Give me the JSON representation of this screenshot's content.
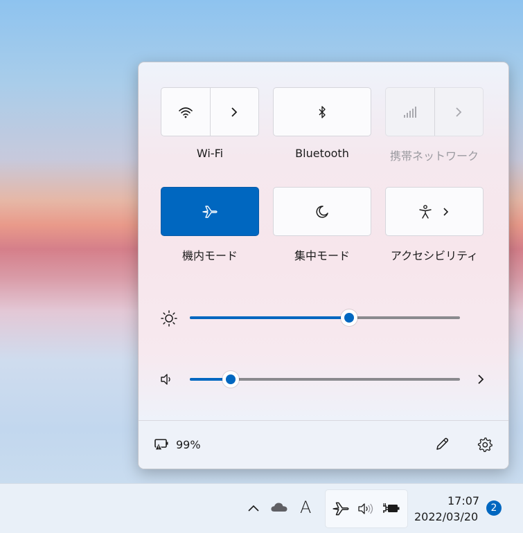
{
  "quick_settings": {
    "tiles": [
      {
        "id": "wifi",
        "label": "Wi-Fi",
        "icon": "wifi-icon",
        "state": "on"
      },
      {
        "id": "bluetooth",
        "label": "Bluetooth",
        "icon": "bluetooth-icon",
        "state": "on"
      },
      {
        "id": "cellular",
        "label": "携帯ネットワーク",
        "icon": "cellular-signal-icon",
        "state": "disabled"
      },
      {
        "id": "airplane",
        "label": "機内モード",
        "icon": "airplane-icon",
        "state": "active"
      },
      {
        "id": "focus",
        "label": "集中モード",
        "icon": "moon-icon",
        "state": "off"
      },
      {
        "id": "accessibility",
        "label": "アクセシビリティ",
        "icon": "accessibility-icon",
        "state": "off"
      }
    ],
    "sliders": {
      "brightness": {
        "icon": "sun-icon",
        "value_percent": 59
      },
      "volume": {
        "icon": "speaker-icon",
        "value_percent": 15
      }
    },
    "footer": {
      "battery_percent": "99%",
      "battery_icon": "battery-warning-icon",
      "edit_icon": "pencil-icon",
      "settings_icon": "gear-icon"
    }
  },
  "taskbar": {
    "tray_icons": [
      "chevron-up-icon",
      "cloud-icon",
      "ime-icon",
      "airplane-icon",
      "speaker-icon",
      "battery-charging-icon"
    ],
    "ime_label": "A",
    "time": "17:07",
    "date": "2022/03/20",
    "notification_count": "2"
  },
  "colors": {
    "accent": "#0067c0"
  }
}
